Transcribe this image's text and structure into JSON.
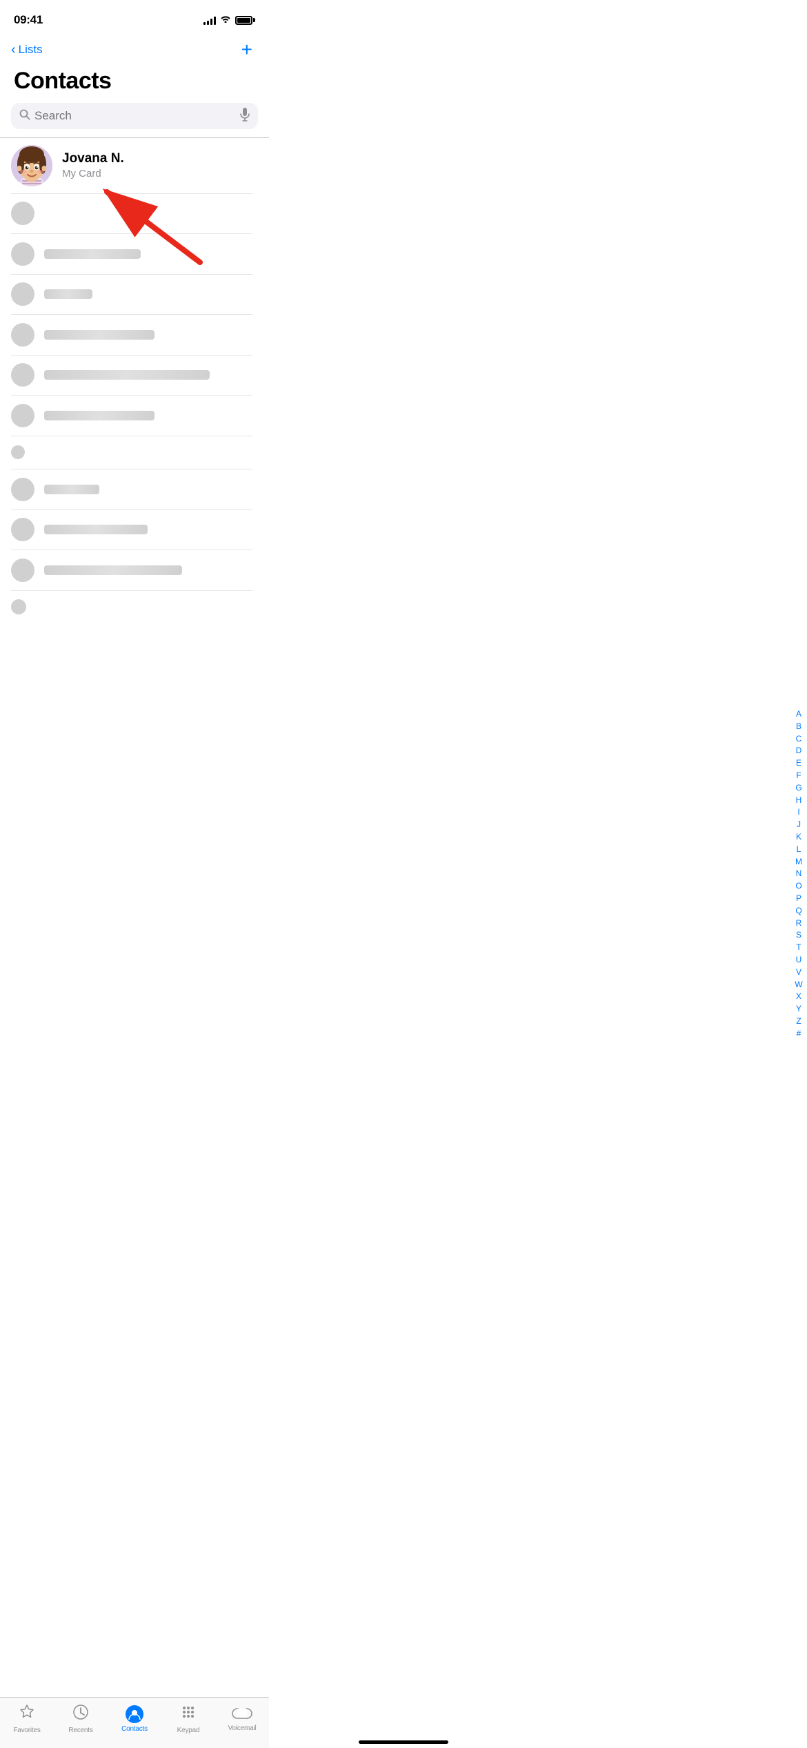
{
  "statusBar": {
    "time": "09:41"
  },
  "header": {
    "backLabel": "Lists",
    "addLabel": "+",
    "title": "Contacts"
  },
  "search": {
    "placeholder": "Search"
  },
  "myCard": {
    "name": "Jovana N.",
    "label": "My Card"
  },
  "alphabetIndex": [
    "A",
    "B",
    "C",
    "D",
    "E",
    "F",
    "G",
    "H",
    "I",
    "J",
    "K",
    "L",
    "M",
    "N",
    "O",
    "P",
    "Q",
    "R",
    "S",
    "T",
    "U",
    "V",
    "W",
    "X",
    "Y",
    "Z",
    "#"
  ],
  "tabBar": {
    "items": [
      {
        "id": "favorites",
        "label": "Favorites",
        "active": false
      },
      {
        "id": "recents",
        "label": "Recents",
        "active": false
      },
      {
        "id": "contacts",
        "label": "Contacts",
        "active": true
      },
      {
        "id": "keypad",
        "label": "Keypad",
        "active": false
      },
      {
        "id": "voicemail",
        "label": "Voicemail",
        "active": false
      }
    ]
  }
}
